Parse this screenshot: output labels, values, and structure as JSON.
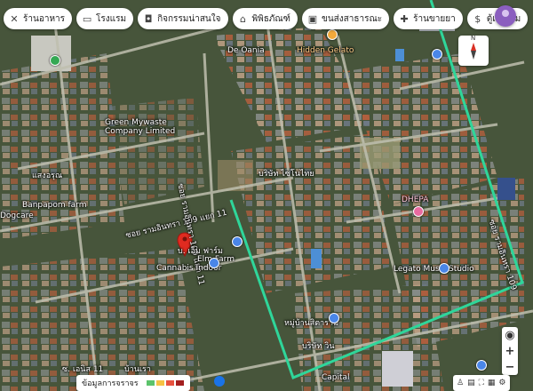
{
  "categories": [
    {
      "label": "ร้านอาหาร",
      "icon": "fork-knife-icon"
    },
    {
      "label": "โรงแรม",
      "icon": "bed-icon"
    },
    {
      "label": "กิจกรรมน่าสนใจ",
      "icon": "camera-icon"
    },
    {
      "label": "พิพิธภัณฑ์",
      "icon": "museum-icon"
    },
    {
      "label": "ขนส่งสาธารณะ",
      "icon": "bus-icon"
    },
    {
      "label": "ร้านขายยา",
      "icon": "pharmacy-icon"
    },
    {
      "label": "ตู้เอทีเอ็ม",
      "icon": "atm-icon"
    }
  ],
  "map_labels": {
    "road_left": "ซอย รามอินทรา 109 แยก 11",
    "road_mid": "ซอย รามอินทรา 109 แยก 11",
    "road_right": "ซอย รามอินทรา 109",
    "place_elm": "Elm Farm",
    "place_elm_th": "บ. เอ็ม ฟาร์ม",
    "place_cannabis": "Cannabis Indoor",
    "place_green": "Green Mywaste Company Limited",
    "place_banpapom": "Banpapom farm",
    "place_dhepa": "DHEPA",
    "place_legato": "Legato Music Studio",
    "place_hidden": "Hidden Gelato",
    "place_deoania": "De Oania",
    "place_sino": "บริษัท ไซโนไทย",
    "place_dogcare": "Dogcare",
    "place_sangaroon": "แสงอรุณ",
    "place_capital": "Capital",
    "place_village": "หมู่บ้านสิตาราม",
    "place_bottom_left": "ซ. เอนิส 11",
    "place_bottom_mid": "บ้านเรา",
    "place_bottom_right": "บริษัท วิน"
  },
  "traffic_label": "ข้อมูลการจราจร",
  "traffic_colors": [
    "#5cc36b",
    "#f6c244",
    "#e8523f",
    "#a31f1f"
  ],
  "compass_letter": "N",
  "route_color": "#2fd69a",
  "pin_color": "#e02b20"
}
